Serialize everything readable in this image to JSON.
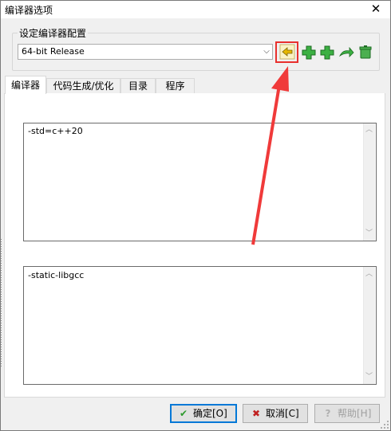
{
  "window": {
    "title": "编译器选项",
    "close_glyph": "✕"
  },
  "compiler_set": {
    "group_label": "设定编译器配置",
    "selected": "64-bit Release",
    "toolbar": [
      {
        "name": "rename-compiler-set-icon",
        "glyph": "✎"
      },
      {
        "name": "add-compiler-set-icon",
        "glyph": "+"
      },
      {
        "name": "add-empty-compiler-set-icon",
        "glyph": "+"
      },
      {
        "name": "redirect-compiler-set-icon",
        "glyph": "↷"
      },
      {
        "name": "delete-compiler-set-icon",
        "glyph": "🗑"
      }
    ],
    "highlight_color": "#e8302d"
  },
  "tabs": [
    {
      "label": "编译器",
      "active": true
    },
    {
      "label": "代码生成/优化",
      "active": false
    },
    {
      "label": "目录",
      "active": false
    },
    {
      "label": "程序",
      "active": false
    }
  ],
  "compiler_tab": {
    "compile_options": "-std=c++20",
    "linker_options": "-static-libgcc"
  },
  "buttons": {
    "ok": "确定[O]",
    "cancel": "取消[C]",
    "help": "帮助[H]"
  },
  "colors": {
    "arrow": "#f03a3a",
    "ok_check": "#2d9a2d",
    "cancel_x": "#c02020",
    "accent": "#0078d7"
  }
}
